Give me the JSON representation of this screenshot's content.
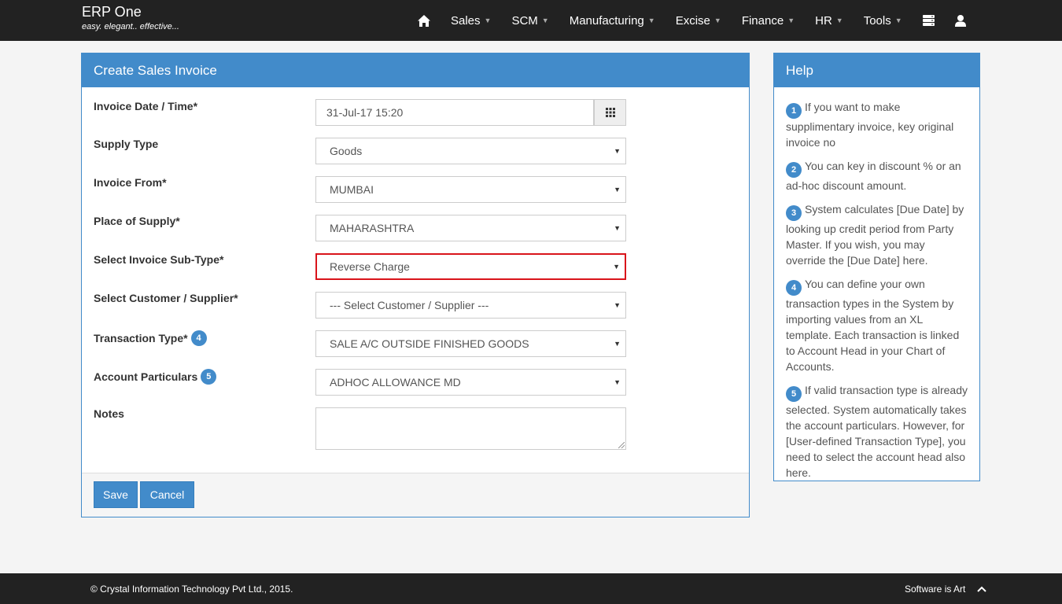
{
  "brand": {
    "name": "ERP One",
    "tagline": "easy. elegant.. effective..."
  },
  "nav": {
    "items": [
      {
        "label": "Sales"
      },
      {
        "label": "SCM"
      },
      {
        "label": "Manufacturing"
      },
      {
        "label": "Excise"
      },
      {
        "label": "Finance"
      },
      {
        "label": "HR"
      },
      {
        "label": "Tools"
      }
    ],
    "icons": [
      "home-icon",
      "server-icon",
      "user-icon"
    ]
  },
  "form": {
    "title": "Create Sales Invoice",
    "fields": {
      "invoice_date": {
        "label": "Invoice Date / Time*",
        "value": "31-Jul-17 15:20"
      },
      "supply_type": {
        "label": "Supply Type",
        "value": "Goods"
      },
      "invoice_from": {
        "label": "Invoice From*",
        "value": "MUMBAI"
      },
      "place_of_supply": {
        "label": "Place of Supply*",
        "value": "MAHARASHTRA"
      },
      "invoice_subtype": {
        "label": "Select Invoice Sub-Type*",
        "value": "Reverse Charge"
      },
      "customer": {
        "label": "Select Customer / Supplier*",
        "value": "--- Select Customer / Supplier ---"
      },
      "transaction_type": {
        "label": "Transaction Type*",
        "badge": "4",
        "value": "SALE A/C OUTSIDE FINISHED GOODS"
      },
      "account_particulars": {
        "label": "Account Particulars",
        "badge": "5",
        "value": "ADHOC ALLOWANCE MD"
      },
      "notes": {
        "label": "Notes",
        "value": ""
      }
    },
    "buttons": {
      "save": "Save",
      "cancel": "Cancel"
    }
  },
  "help": {
    "title": "Help",
    "items": [
      {
        "num": "1",
        "text": "If you want to make supplimentary invoice, key original invoice no"
      },
      {
        "num": "2",
        "text": "You can key in discount % or an ad-hoc discount amount."
      },
      {
        "num": "3",
        "text": "System calculates [Due Date] by looking up credit period from Party Master. If you wish, you may override the [Due Date] here."
      },
      {
        "num": "4",
        "text": "You can define your own transaction types in the System by importing values from an XL template. Each transaction is linked to Account Head in your Chart of Accounts."
      },
      {
        "num": "5",
        "text": "If valid transaction type is already selected. System automatically takes the account particulars. However, for [User-defined Transaction Type], you need to select the account head also here."
      }
    ]
  },
  "footer": {
    "copyright": "© Crystal Information Technology Pvt Ltd., 2015.",
    "tagline": "Software is Art"
  },
  "colors": {
    "primary": "#428bca",
    "navbar": "#222222",
    "highlight": "#d9141b"
  }
}
